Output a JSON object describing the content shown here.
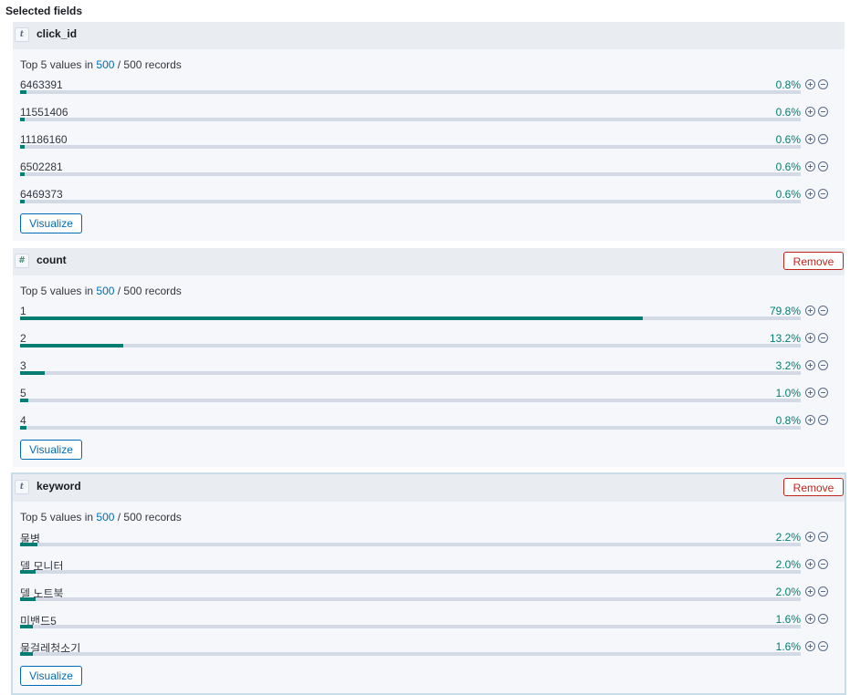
{
  "section_title": "Selected fields",
  "summary_prefix": "Top 5 values in ",
  "summary_suffix": " / 500 records",
  "summary_count": "500",
  "visualize_label": "Visualize",
  "remove_label": "Remove",
  "fields": [
    {
      "name": "click_id",
      "type_icon": "t",
      "type": "string",
      "has_remove": false,
      "values": [
        {
          "label": "6463391",
          "pct": "0.8%",
          "fraction": 0.008
        },
        {
          "label": "11551406",
          "pct": "0.6%",
          "fraction": 0.006
        },
        {
          "label": "11186160",
          "pct": "0.6%",
          "fraction": 0.006
        },
        {
          "label": "6502281",
          "pct": "0.6%",
          "fraction": 0.006
        },
        {
          "label": "6469373",
          "pct": "0.6%",
          "fraction": 0.006
        }
      ]
    },
    {
      "name": "count",
      "type_icon": "#",
      "type": "number",
      "has_remove": true,
      "values": [
        {
          "label": "1",
          "pct": "79.8%",
          "fraction": 0.798
        },
        {
          "label": "2",
          "pct": "13.2%",
          "fraction": 0.132
        },
        {
          "label": "3",
          "pct": "3.2%",
          "fraction": 0.032
        },
        {
          "label": "5",
          "pct": "1.0%",
          "fraction": 0.01
        },
        {
          "label": "4",
          "pct": "0.8%",
          "fraction": 0.008
        }
      ]
    },
    {
      "name": "keyword",
      "type_icon": "t",
      "type": "string",
      "has_remove": true,
      "values": [
        {
          "label": "물병",
          "pct": "2.2%",
          "fraction": 0.022
        },
        {
          "label": "델 모니터",
          "pct": "2.0%",
          "fraction": 0.02
        },
        {
          "label": "델 노트북",
          "pct": "2.0%",
          "fraction": 0.02
        },
        {
          "label": "미밴드5",
          "pct": "1.6%",
          "fraction": 0.016
        },
        {
          "label": "물걸레청소기",
          "pct": "1.6%",
          "fraction": 0.016
        }
      ]
    }
  ]
}
